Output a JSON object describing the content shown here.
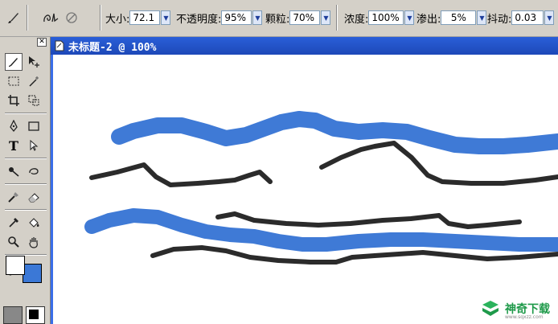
{
  "options_bar": {
    "size": {
      "label": "大小:",
      "value": "72.1"
    },
    "opacity": {
      "label": "不透明度:",
      "value": "95%"
    },
    "grain": {
      "label": "颗粒:",
      "value": "70%"
    },
    "concentration": {
      "label": "浓度:",
      "value": "100%"
    },
    "bleed": {
      "label": "渗出:",
      "value": "5%"
    },
    "jitter": {
      "label": "抖动:",
      "value": "0.03"
    }
  },
  "document": {
    "title": "未标题-2 @ 100%"
  },
  "colors": {
    "foreground": "#ffffff",
    "background": "#3b78d6",
    "title_bar": "#2a5fd8",
    "stroke_blue": "#3f7ad6",
    "stroke_black": "#2b2b2b"
  },
  "watermark": {
    "text": "神奇下载",
    "url": "www.sqxzz.com"
  }
}
